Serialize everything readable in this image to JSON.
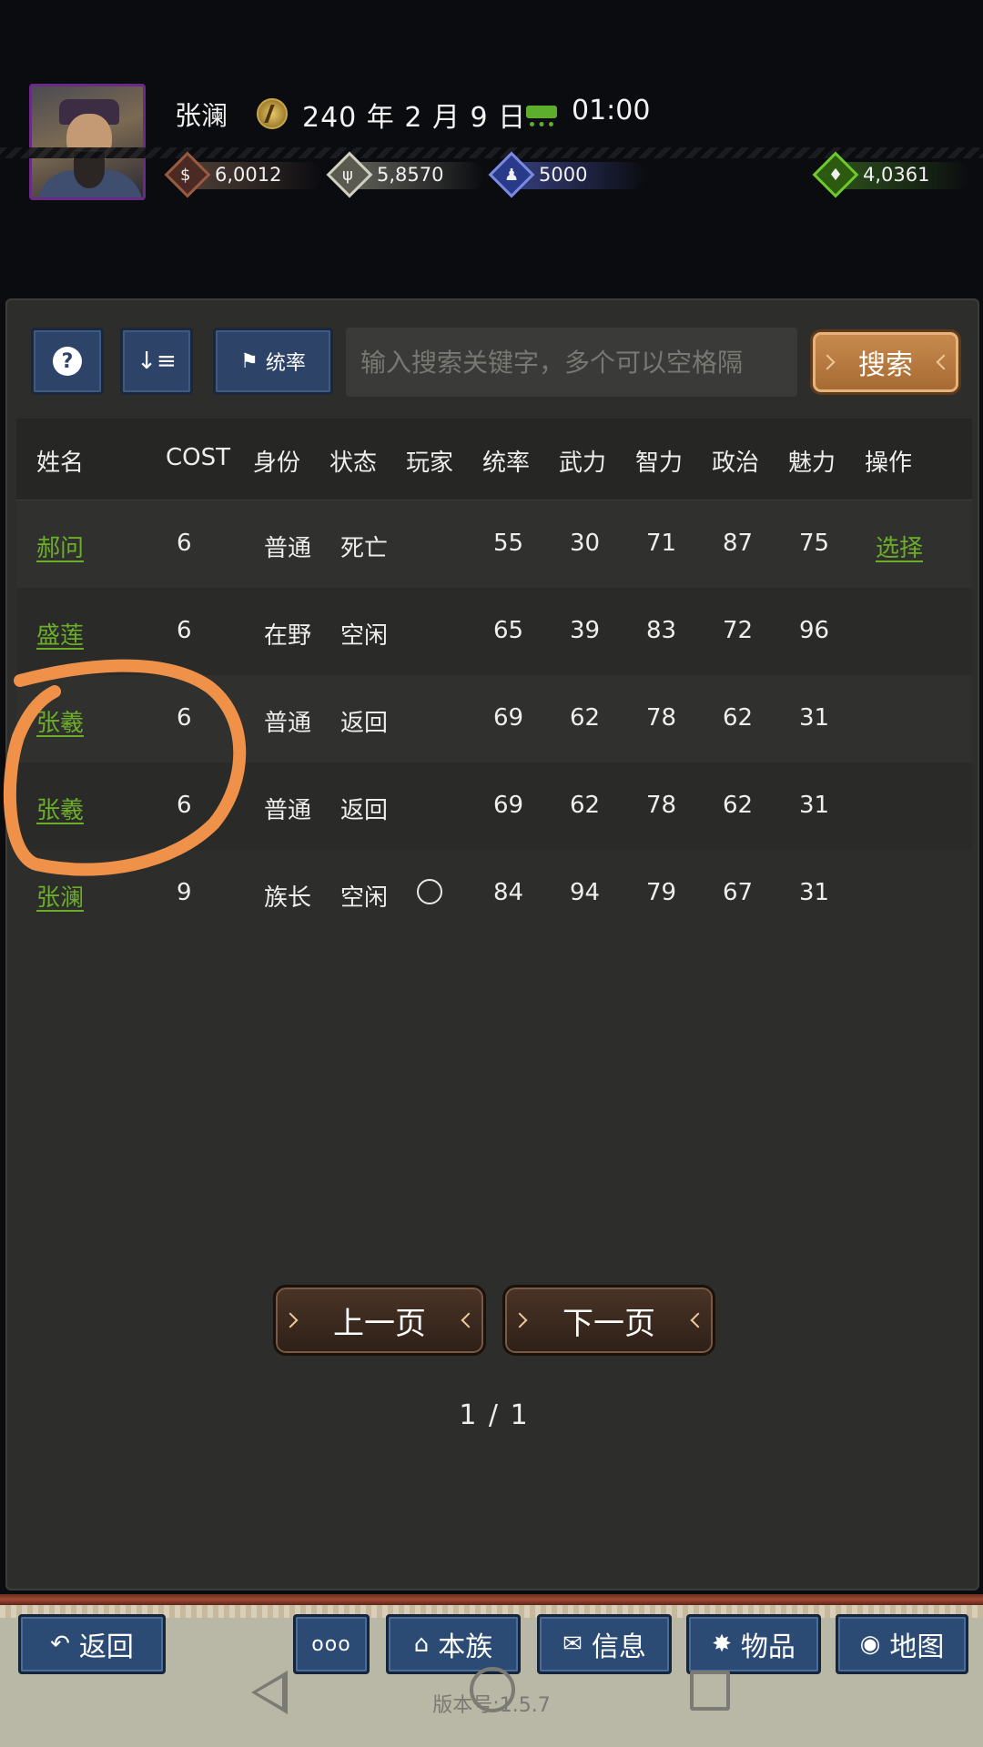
{
  "header": {
    "player_name": "张澜",
    "date": "240 年 2 月 9 日",
    "time": "01:00",
    "resources": {
      "money": "6,0012",
      "food": "5,8570",
      "troops": "5000",
      "bag": "4,0361"
    }
  },
  "toolbar": {
    "filter_label": "统率",
    "search_placeholder": "输入搜索关键字，多个可以空格隔",
    "search_label": "搜索"
  },
  "table": {
    "headers": [
      "姓名",
      "COST",
      "身份",
      "状态",
      "玩家",
      "统率",
      "武力",
      "智力",
      "政治",
      "魅力",
      "操作"
    ],
    "rows": [
      {
        "name": "郝问",
        "cost": "6",
        "identity": "普通",
        "status": "死亡",
        "player": "",
        "lead": "55",
        "war": "30",
        "int": "71",
        "pol": "87",
        "cha": "75",
        "action": "选择"
      },
      {
        "name": "盛莲",
        "cost": "6",
        "identity": "在野",
        "status": "空闲",
        "player": "",
        "lead": "65",
        "war": "39",
        "int": "83",
        "pol": "72",
        "cha": "96",
        "action": ""
      },
      {
        "name": "张羲",
        "cost": "6",
        "identity": "普通",
        "status": "返回",
        "player": "",
        "lead": "69",
        "war": "62",
        "int": "78",
        "pol": "62",
        "cha": "31",
        "action": ""
      },
      {
        "name": "张羲",
        "cost": "6",
        "identity": "普通",
        "status": "返回",
        "player": "",
        "lead": "69",
        "war": "62",
        "int": "78",
        "pol": "62",
        "cha": "31",
        "action": ""
      },
      {
        "name": "张澜",
        "cost": "9",
        "identity": "族长",
        "status": "空闲",
        "player": "○",
        "lead": "84",
        "war": "94",
        "int": "79",
        "pol": "67",
        "cha": "31",
        "action": ""
      }
    ]
  },
  "pagination": {
    "prev_label": "上一页",
    "next_label": "下一页",
    "indicator": "1 / 1"
  },
  "bottom_nav": {
    "back": "返回",
    "more": "ooo",
    "clan": "本族",
    "info": "信息",
    "items": "物品",
    "map": "地图"
  },
  "version": "版本号:1.5.7",
  "colors": {
    "link_green": "#6cae2a",
    "button_blue": "#2d4468",
    "search_orange": "#c98b4e",
    "annotation_orange": "#f0914a"
  }
}
